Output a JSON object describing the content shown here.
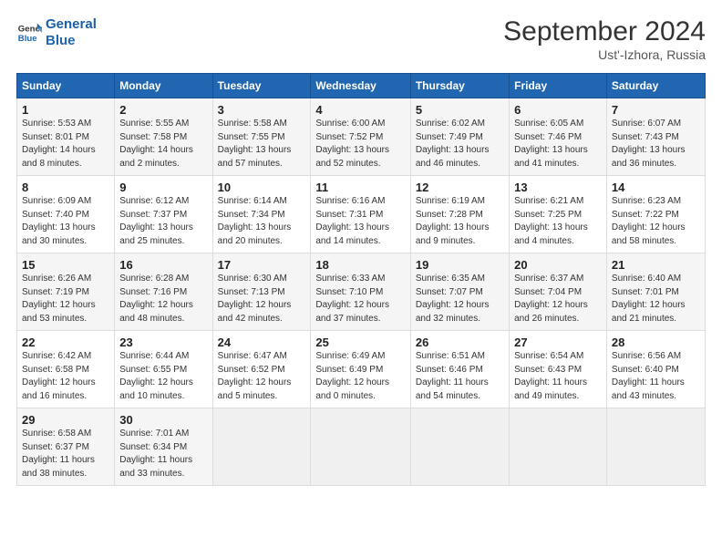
{
  "header": {
    "logo_line1": "General",
    "logo_line2": "Blue",
    "main_title": "September 2024",
    "subtitle": "Ust'-Izhora, Russia"
  },
  "weekdays": [
    "Sunday",
    "Monday",
    "Tuesday",
    "Wednesday",
    "Thursday",
    "Friday",
    "Saturday"
  ],
  "weeks": [
    [
      {
        "day": "1",
        "sunrise": "Sunrise: 5:53 AM",
        "sunset": "Sunset: 8:01 PM",
        "daylight": "Daylight: 14 hours and 8 minutes."
      },
      {
        "day": "2",
        "sunrise": "Sunrise: 5:55 AM",
        "sunset": "Sunset: 7:58 PM",
        "daylight": "Daylight: 14 hours and 2 minutes."
      },
      {
        "day": "3",
        "sunrise": "Sunrise: 5:58 AM",
        "sunset": "Sunset: 7:55 PM",
        "daylight": "Daylight: 13 hours and 57 minutes."
      },
      {
        "day": "4",
        "sunrise": "Sunrise: 6:00 AM",
        "sunset": "Sunset: 7:52 PM",
        "daylight": "Daylight: 13 hours and 52 minutes."
      },
      {
        "day": "5",
        "sunrise": "Sunrise: 6:02 AM",
        "sunset": "Sunset: 7:49 PM",
        "daylight": "Daylight: 13 hours and 46 minutes."
      },
      {
        "day": "6",
        "sunrise": "Sunrise: 6:05 AM",
        "sunset": "Sunset: 7:46 PM",
        "daylight": "Daylight: 13 hours and 41 minutes."
      },
      {
        "day": "7",
        "sunrise": "Sunrise: 6:07 AM",
        "sunset": "Sunset: 7:43 PM",
        "daylight": "Daylight: 13 hours and 36 minutes."
      }
    ],
    [
      {
        "day": "8",
        "sunrise": "Sunrise: 6:09 AM",
        "sunset": "Sunset: 7:40 PM",
        "daylight": "Daylight: 13 hours and 30 minutes."
      },
      {
        "day": "9",
        "sunrise": "Sunrise: 6:12 AM",
        "sunset": "Sunset: 7:37 PM",
        "daylight": "Daylight: 13 hours and 25 minutes."
      },
      {
        "day": "10",
        "sunrise": "Sunrise: 6:14 AM",
        "sunset": "Sunset: 7:34 PM",
        "daylight": "Daylight: 13 hours and 20 minutes."
      },
      {
        "day": "11",
        "sunrise": "Sunrise: 6:16 AM",
        "sunset": "Sunset: 7:31 PM",
        "daylight": "Daylight: 13 hours and 14 minutes."
      },
      {
        "day": "12",
        "sunrise": "Sunrise: 6:19 AM",
        "sunset": "Sunset: 7:28 PM",
        "daylight": "Daylight: 13 hours and 9 minutes."
      },
      {
        "day": "13",
        "sunrise": "Sunrise: 6:21 AM",
        "sunset": "Sunset: 7:25 PM",
        "daylight": "Daylight: 13 hours and 4 minutes."
      },
      {
        "day": "14",
        "sunrise": "Sunrise: 6:23 AM",
        "sunset": "Sunset: 7:22 PM",
        "daylight": "Daylight: 12 hours and 58 minutes."
      }
    ],
    [
      {
        "day": "15",
        "sunrise": "Sunrise: 6:26 AM",
        "sunset": "Sunset: 7:19 PM",
        "daylight": "Daylight: 12 hours and 53 minutes."
      },
      {
        "day": "16",
        "sunrise": "Sunrise: 6:28 AM",
        "sunset": "Sunset: 7:16 PM",
        "daylight": "Daylight: 12 hours and 48 minutes."
      },
      {
        "day": "17",
        "sunrise": "Sunrise: 6:30 AM",
        "sunset": "Sunset: 7:13 PM",
        "daylight": "Daylight: 12 hours and 42 minutes."
      },
      {
        "day": "18",
        "sunrise": "Sunrise: 6:33 AM",
        "sunset": "Sunset: 7:10 PM",
        "daylight": "Daylight: 12 hours and 37 minutes."
      },
      {
        "day": "19",
        "sunrise": "Sunrise: 6:35 AM",
        "sunset": "Sunset: 7:07 PM",
        "daylight": "Daylight: 12 hours and 32 minutes."
      },
      {
        "day": "20",
        "sunrise": "Sunrise: 6:37 AM",
        "sunset": "Sunset: 7:04 PM",
        "daylight": "Daylight: 12 hours and 26 minutes."
      },
      {
        "day": "21",
        "sunrise": "Sunrise: 6:40 AM",
        "sunset": "Sunset: 7:01 PM",
        "daylight": "Daylight: 12 hours and 21 minutes."
      }
    ],
    [
      {
        "day": "22",
        "sunrise": "Sunrise: 6:42 AM",
        "sunset": "Sunset: 6:58 PM",
        "daylight": "Daylight: 12 hours and 16 minutes."
      },
      {
        "day": "23",
        "sunrise": "Sunrise: 6:44 AM",
        "sunset": "Sunset: 6:55 PM",
        "daylight": "Daylight: 12 hours and 10 minutes."
      },
      {
        "day": "24",
        "sunrise": "Sunrise: 6:47 AM",
        "sunset": "Sunset: 6:52 PM",
        "daylight": "Daylight: 12 hours and 5 minutes."
      },
      {
        "day": "25",
        "sunrise": "Sunrise: 6:49 AM",
        "sunset": "Sunset: 6:49 PM",
        "daylight": "Daylight: 12 hours and 0 minutes."
      },
      {
        "day": "26",
        "sunrise": "Sunrise: 6:51 AM",
        "sunset": "Sunset: 6:46 PM",
        "daylight": "Daylight: 11 hours and 54 minutes."
      },
      {
        "day": "27",
        "sunrise": "Sunrise: 6:54 AM",
        "sunset": "Sunset: 6:43 PM",
        "daylight": "Daylight: 11 hours and 49 minutes."
      },
      {
        "day": "28",
        "sunrise": "Sunrise: 6:56 AM",
        "sunset": "Sunset: 6:40 PM",
        "daylight": "Daylight: 11 hours and 43 minutes."
      }
    ],
    [
      {
        "day": "29",
        "sunrise": "Sunrise: 6:58 AM",
        "sunset": "Sunset: 6:37 PM",
        "daylight": "Daylight: 11 hours and 38 minutes."
      },
      {
        "day": "30",
        "sunrise": "Sunrise: 7:01 AM",
        "sunset": "Sunset: 6:34 PM",
        "daylight": "Daylight: 11 hours and 33 minutes."
      },
      null,
      null,
      null,
      null,
      null
    ]
  ]
}
